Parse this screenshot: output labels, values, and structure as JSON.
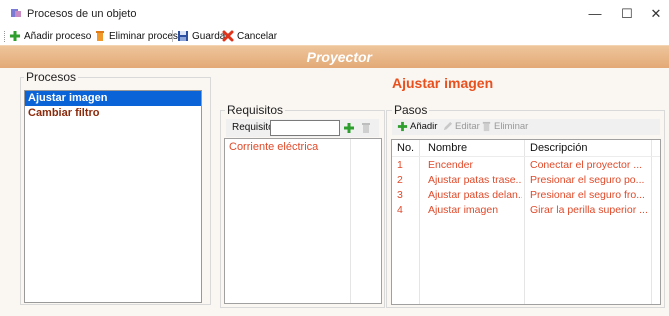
{
  "window": {
    "title": "Procesos de un objeto",
    "minimize_glyph": "—",
    "maximize_glyph": "☐",
    "close_glyph": "✕"
  },
  "toolbar": {
    "add_label": "Añadir proceso",
    "delete_label": "Eliminar proceso",
    "save_label": "Guardar",
    "cancel_label": "Cancelar"
  },
  "header": {
    "object_name": "Proyector"
  },
  "procesos": {
    "label": "Procesos",
    "items": [
      "Ajustar imagen",
      "Cambiar filtro"
    ],
    "selected_index": 0
  },
  "selected_process_title": "Ajustar imagen",
  "requisitos": {
    "label": "Requisitos",
    "input_label": "Requisito:",
    "input_value": "",
    "items": [
      "Corriente eléctrica"
    ]
  },
  "pasos": {
    "label": "Pasos",
    "add_label": "Añadir",
    "edit_label": "Editar",
    "delete_label": "Eliminar",
    "columns": [
      "No.",
      "Nombre",
      "Descripción"
    ],
    "rows": [
      {
        "no": "1",
        "nombre": "Encender",
        "descripcion": "Conectar el proyector ..."
      },
      {
        "no": "2",
        "nombre": "Ajustar patas trase...",
        "descripcion": "Presionar el seguro po..."
      },
      {
        "no": "3",
        "nombre": "Ajustar patas delan...",
        "descripcion": "Presionar el seguro fro..."
      },
      {
        "no": "4",
        "nombre": "Ajustar imagen",
        "descripcion": "Girar la perilla superior ..."
      }
    ]
  },
  "colors": {
    "accent_orange": "#e8501e",
    "header_band": "#e3a976",
    "selection_blue": "#0a64d8",
    "row_text": "#e04a2a",
    "process_text": "#8b2a0b"
  }
}
